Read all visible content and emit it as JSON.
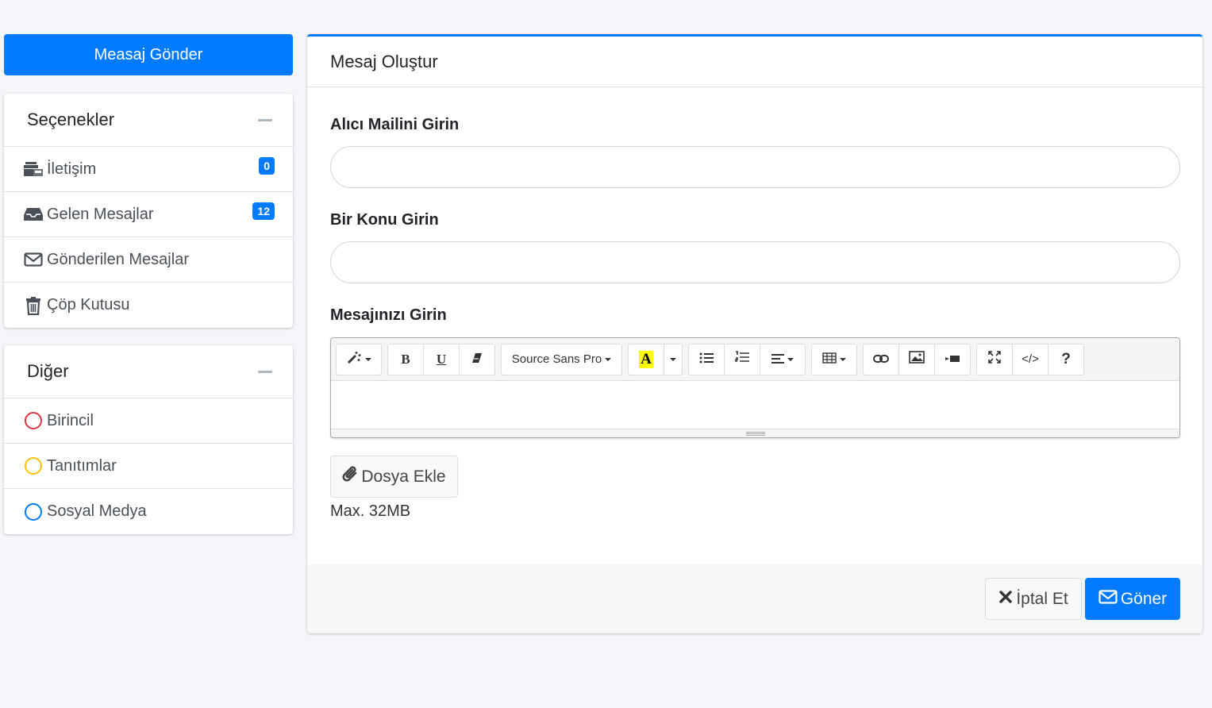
{
  "sidebar": {
    "compose_label": "Measaj Gönder",
    "options": {
      "title": "Seçenekler",
      "items": [
        {
          "label": "İletişim",
          "icon": "inbox-stack-icon",
          "badge": "0"
        },
        {
          "label": "Gelen Mesajlar",
          "icon": "inbox-icon",
          "badge": "12"
        },
        {
          "label": "Gönderilen Mesajlar",
          "icon": "envelope-icon"
        },
        {
          "label": "Çöp Kutusu",
          "icon": "trash-icon"
        }
      ]
    },
    "other": {
      "title": "Diğer",
      "items": [
        {
          "label": "Birincil",
          "icon": "circle-icon",
          "color": "#dc3545"
        },
        {
          "label": "Tanıtımlar",
          "icon": "circle-icon",
          "color": "#ffc107"
        },
        {
          "label": "Sosyal Medya",
          "icon": "circle-icon",
          "color": "#007bff"
        }
      ]
    }
  },
  "main": {
    "title": "Mesaj Oluştur",
    "recipient_label": "Alıcı Mailini Girin",
    "recipient_value": "",
    "subject_label": "Bir Konu Girin",
    "subject_value": "",
    "message_label": "Mesajınızı Girin",
    "editor": {
      "font_name": "Source Sans Pro",
      "bold": "B",
      "underline": "U",
      "forecolor": "A",
      "help": "?",
      "code": "</>"
    },
    "attach_label": "Dosya Ekle",
    "attach_help": "Max. 32MB",
    "cancel_label": "İptal Et",
    "send_label": "Göner"
  },
  "colors": {
    "primary": "#007bff",
    "background": "#f4f6f9"
  }
}
